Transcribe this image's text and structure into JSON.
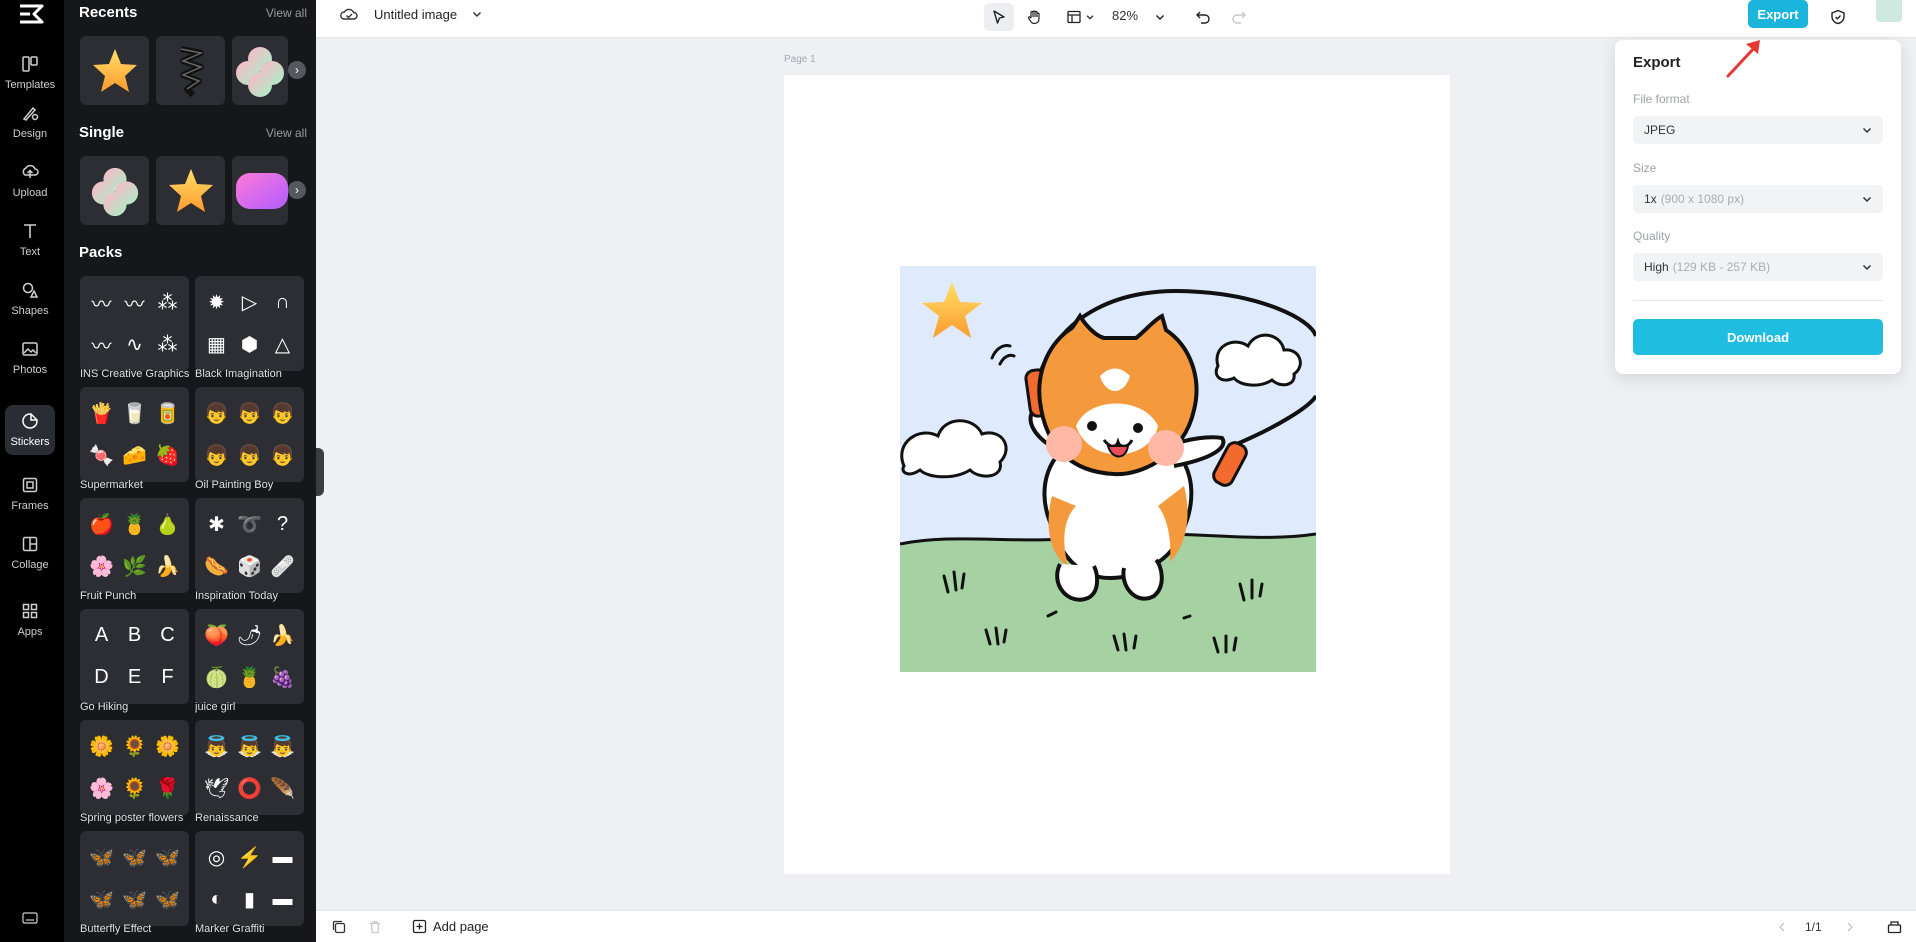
{
  "rail": {
    "items": [
      {
        "label": "Templates",
        "icon": "templates-icon"
      },
      {
        "label": "Design",
        "icon": "design-icon"
      },
      {
        "label": "Upload",
        "icon": "upload-icon"
      },
      {
        "label": "Text",
        "icon": "text-icon"
      },
      {
        "label": "Shapes",
        "icon": "shapes-icon"
      },
      {
        "label": "Photos",
        "icon": "photos-icon"
      },
      {
        "label": "Stickers",
        "icon": "stickers-icon",
        "active": true
      },
      {
        "label": "Frames",
        "icon": "frames-icon"
      },
      {
        "label": "Collage",
        "icon": "collage-icon"
      },
      {
        "label": "Apps",
        "icon": "apps-icon"
      }
    ]
  },
  "panel": {
    "recents": {
      "title": "Recents",
      "view_all": "View all"
    },
    "single": {
      "title": "Single",
      "view_all": "View all"
    },
    "packs": {
      "title": "Packs",
      "items": [
        {
          "label": "INS Creative Graphics",
          "glyphs": [
            "〰",
            "〰",
            "⁂",
            "〰",
            "∿",
            "⁂"
          ]
        },
        {
          "label": "Black Imagination",
          "glyphs": [
            "✹",
            "▷",
            "∩",
            "▦",
            "⬢",
            "△"
          ]
        },
        {
          "label": "Supermarket",
          "glyphs": [
            "🍟",
            "🥛",
            "🥫",
            "🍬",
            "🧀",
            "🍓"
          ]
        },
        {
          "label": "Oil Painting Boy",
          "glyphs": [
            "👦",
            "👦",
            "👦",
            "👦",
            "👦",
            "👦"
          ]
        },
        {
          "label": "Fruit Punch",
          "glyphs": [
            "🍎",
            "🍍",
            "🍐",
            "🌸",
            "🌿",
            "🍌"
          ]
        },
        {
          "label": "Inspiration Today",
          "glyphs": [
            "✱",
            "➰",
            "?",
            "🌭",
            "🎲",
            "🩹"
          ]
        },
        {
          "label": "Go Hiking",
          "glyphs": [
            "A",
            "B",
            "C",
            "D",
            "E",
            "F"
          ]
        },
        {
          "label": "juice girl",
          "glyphs": [
            "🍑",
            "🌶",
            "🍌",
            "🍈",
            "🍍",
            "🍇"
          ]
        },
        {
          "label": "Spring poster flowers",
          "glyphs": [
            "🌼",
            "🌻",
            "🌼",
            "🌸",
            "🌻",
            "🌹"
          ]
        },
        {
          "label": "Renaissance",
          "glyphs": [
            "👼",
            "👼",
            "👼",
            "🕊",
            "⭕",
            "🪶"
          ]
        },
        {
          "label": "Butterfly Effect",
          "glyphs": [
            "🦋",
            "🦋",
            "🦋",
            "🦋",
            "🦋",
            "🦋"
          ]
        },
        {
          "label": "Marker Graffiti",
          "glyphs": [
            "◎",
            "⚡",
            "▬",
            "◐",
            "▮",
            "▬"
          ]
        }
      ]
    }
  },
  "topbar": {
    "title": "Untitled image",
    "zoom": "82%",
    "export_label": "Export"
  },
  "canvas": {
    "page_label": "Page 1"
  },
  "bottombar": {
    "add_page": "Add page",
    "pager": "1/1"
  },
  "export_panel": {
    "title": "Export",
    "file_format_label": "File format",
    "file_format_value": "JPEG",
    "size_label": "Size",
    "size_value": "1x",
    "size_detail": "(900 x 1080 px)",
    "quality_label": "Quality",
    "quality_value": "High",
    "quality_detail": "(129 KB - 257 KB)",
    "download_label": "Download"
  },
  "colors": {
    "accent": "#1bb4dd",
    "rail_bg": "#000000",
    "panel_bg": "#16171a",
    "sky": "#dfeafc",
    "grass": "#a6d1a3",
    "cat_orange": "#f59a3c"
  }
}
